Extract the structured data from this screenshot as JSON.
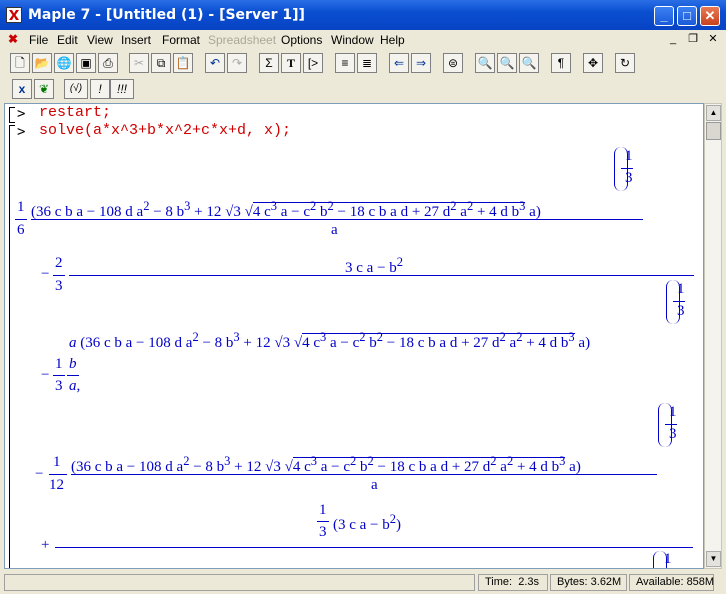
{
  "window": {
    "title": "Maple 7  - [Untitled (1) - [Server 1]]"
  },
  "menu": [
    "File",
    "Edit",
    "View",
    "Insert",
    "Format",
    "Spreadsheet",
    "Options",
    "Window",
    "Help"
  ],
  "toolbar1": [
    "new",
    "open",
    "open-url",
    "save",
    "print",
    "cut",
    "copy",
    "paste",
    "undo",
    "redo",
    "sigma",
    "T",
    "exec",
    "indent",
    "outdent",
    "back",
    "forward",
    "stop",
    "zoom-in-small",
    "zoom-in-medium",
    "zoom-in-large",
    "pilcrow",
    "expand",
    "restart"
  ],
  "toolbar2": {
    "x": "x",
    "check": "(√)",
    "bang": "!",
    "bangs": "!!!"
  },
  "worksheet": {
    "prompt": ">",
    "line1": "restart;",
    "line2": "solve(a*x^3+b*x^2+c*x+d, x);",
    "out": {
      "one": "1",
      "six": "6",
      "two": "2",
      "three": "3",
      "twelve": "12",
      "b": "b",
      "a": "a",
      "big": "(36 c b a − 108 d a",
      "big2": " − 8 b",
      "big3": " + 12 √3 √",
      "rad": "4 c",
      "rad2": " a − c",
      "rad3": " b",
      "rad4": " − 18 c b a d + 27 d",
      "rad5": " a",
      "rad6": " + 4 d b",
      "close": " a)",
      "minus": "−",
      "plus": "+",
      "num2": "3 c a − b",
      "sq": "2",
      "cube": "3",
      "semi": ",",
      "third_open": "(3 c a − b",
      "third_close": ")"
    }
  },
  "status": {
    "time_label": "Time:",
    "time": "2.3s",
    "bytes_label": "Bytes:",
    "bytes": "3.62M",
    "avail_label": "Available:",
    "avail": "858M"
  }
}
